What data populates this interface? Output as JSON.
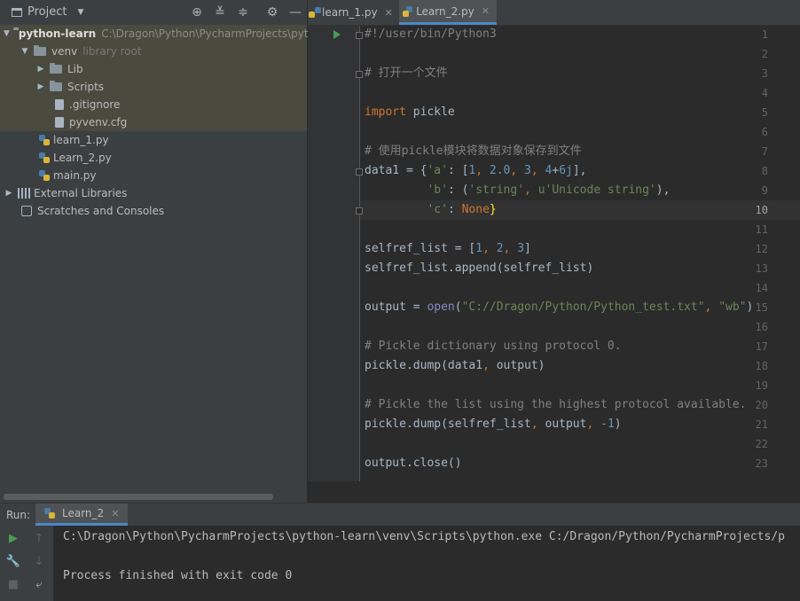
{
  "project_panel": {
    "title": "Project",
    "tree": [
      {
        "label": "python-learn",
        "extra": "C:\\Dragon\\Python\\PycharmProjects\\pytho"
      },
      {
        "label": "venv",
        "extra": "library root"
      },
      {
        "label": "Lib"
      },
      {
        "label": "Scripts"
      },
      {
        "label": ".gitignore"
      },
      {
        "label": "pyvenv.cfg"
      },
      {
        "label": "learn_1.py"
      },
      {
        "label": "Learn_2.py"
      },
      {
        "label": "main.py"
      },
      {
        "label": "External Libraries"
      },
      {
        "label": "Scratches and Consoles"
      }
    ]
  },
  "editor": {
    "tabs": [
      {
        "label": "learn_1.py",
        "close": "✕"
      },
      {
        "label": "Learn_2.py",
        "close": "✕"
      }
    ],
    "current_line": 10,
    "line_numbers": [
      "1",
      "2",
      "3",
      "4",
      "5",
      "6",
      "7",
      "8",
      "9",
      "10",
      "11",
      "12",
      "13",
      "14",
      "15",
      "16",
      "17",
      "18",
      "19",
      "20",
      "21",
      "22",
      "23"
    ],
    "tokens": {
      "l1": "#!/user/bin/Python3",
      "l3": "# 打开一个文件",
      "l5_kw": "import",
      "l5_rest": " pickle",
      "l7": "# 使用pickle模块将数据对象保存到文件",
      "l8_a": "data1 = {",
      "l8_s1": "'a'",
      "l8_b": ": [",
      "l8_n1": "1",
      "l8_c1": ", ",
      "l8_n2": "2.0",
      "l8_c2": ", ",
      "l8_n3": "3",
      "l8_c3": ", ",
      "l8_n4": "4",
      "l8_plus": "+",
      "l8_n5": "6j",
      "l8_end": "],",
      "l9_pad": "         ",
      "l9_s1": "'b'",
      "l9_b": ": (",
      "l9_s2": "'string'",
      "l9_c": ", ",
      "l9_s3": "u'Unicode string'",
      "l9_end": "),",
      "l10_pad": "         ",
      "l10_s1": "'c'",
      "l10_b": ": ",
      "l10_kw": "None",
      "l10_end": "}",
      "l12_a": "selfref_list = [",
      "l12_n1": "1",
      "l12_c1": ", ",
      "l12_n2": "2",
      "l12_c2": ", ",
      "l12_n3": "3",
      "l12_end": "]",
      "l13": "selfref_list.append(selfref_list)",
      "l15_a": "output = ",
      "l15_bi": "open",
      "l15_b": "(",
      "l15_s1": "\"C://Dragon/Python/Python_test.txt\"",
      "l15_c": ", ",
      "l15_s2": "\"wb\"",
      "l15_end": ")",
      "l17": "# Pickle dictionary using protocol 0.",
      "l18_a": "pickle.dump(data1",
      "l18_c": ", ",
      "l18_b": "output)",
      "l20": "# Pickle the list using the highest protocol available.",
      "l21_a": "pickle.dump(selfref_list",
      "l21_c1": ", ",
      "l21_b": "output",
      "l21_c2": ", ",
      "l21_n": "-1",
      "l21_end": ")",
      "l23": "output.close()"
    }
  },
  "run_panel": {
    "label": "Run:",
    "tab_label": "Learn_2",
    "tab_close": "✕",
    "console": [
      "C:\\Dragon\\Python\\PycharmProjects\\python-learn\\venv\\Scripts\\python.exe C:/Dragon/Python/PycharmProjects/p",
      "",
      "Process finished with exit code 0"
    ]
  },
  "colors": {
    "keyword": "#cc7832",
    "comment": "#808080",
    "string": "#6a8759",
    "number": "#6897bb",
    "builtin": "#8888c6",
    "accent": "#4a88c7",
    "run_green": "#499c54"
  }
}
